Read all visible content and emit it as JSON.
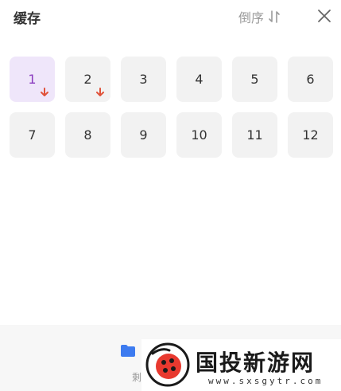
{
  "header": {
    "title": "缓存",
    "sort_label": "倒序"
  },
  "episodes": [
    {
      "label": "1",
      "selected": true,
      "downloading": true
    },
    {
      "label": "2",
      "selected": false,
      "downloading": true
    },
    {
      "label": "3",
      "selected": false,
      "downloading": false
    },
    {
      "label": "4",
      "selected": false,
      "downloading": false
    },
    {
      "label": "5",
      "selected": false,
      "downloading": false
    },
    {
      "label": "6",
      "selected": false,
      "downloading": false
    },
    {
      "label": "7",
      "selected": false,
      "downloading": false
    },
    {
      "label": "8",
      "selected": false,
      "downloading": false
    },
    {
      "label": "9",
      "selected": false,
      "downloading": false
    },
    {
      "label": "10",
      "selected": false,
      "downloading": false
    },
    {
      "label": "11",
      "selected": false,
      "downloading": false
    },
    {
      "label": "12",
      "selected": false,
      "downloading": false
    }
  ],
  "footer": {
    "storage_text": "剩"
  },
  "watermark": {
    "title": "国投新游网",
    "url": "www.sxsgytr.com"
  },
  "colors": {
    "accent": "#8a3bbf",
    "download_arrow": "#e0523a",
    "folder": "#3d7bf0"
  }
}
